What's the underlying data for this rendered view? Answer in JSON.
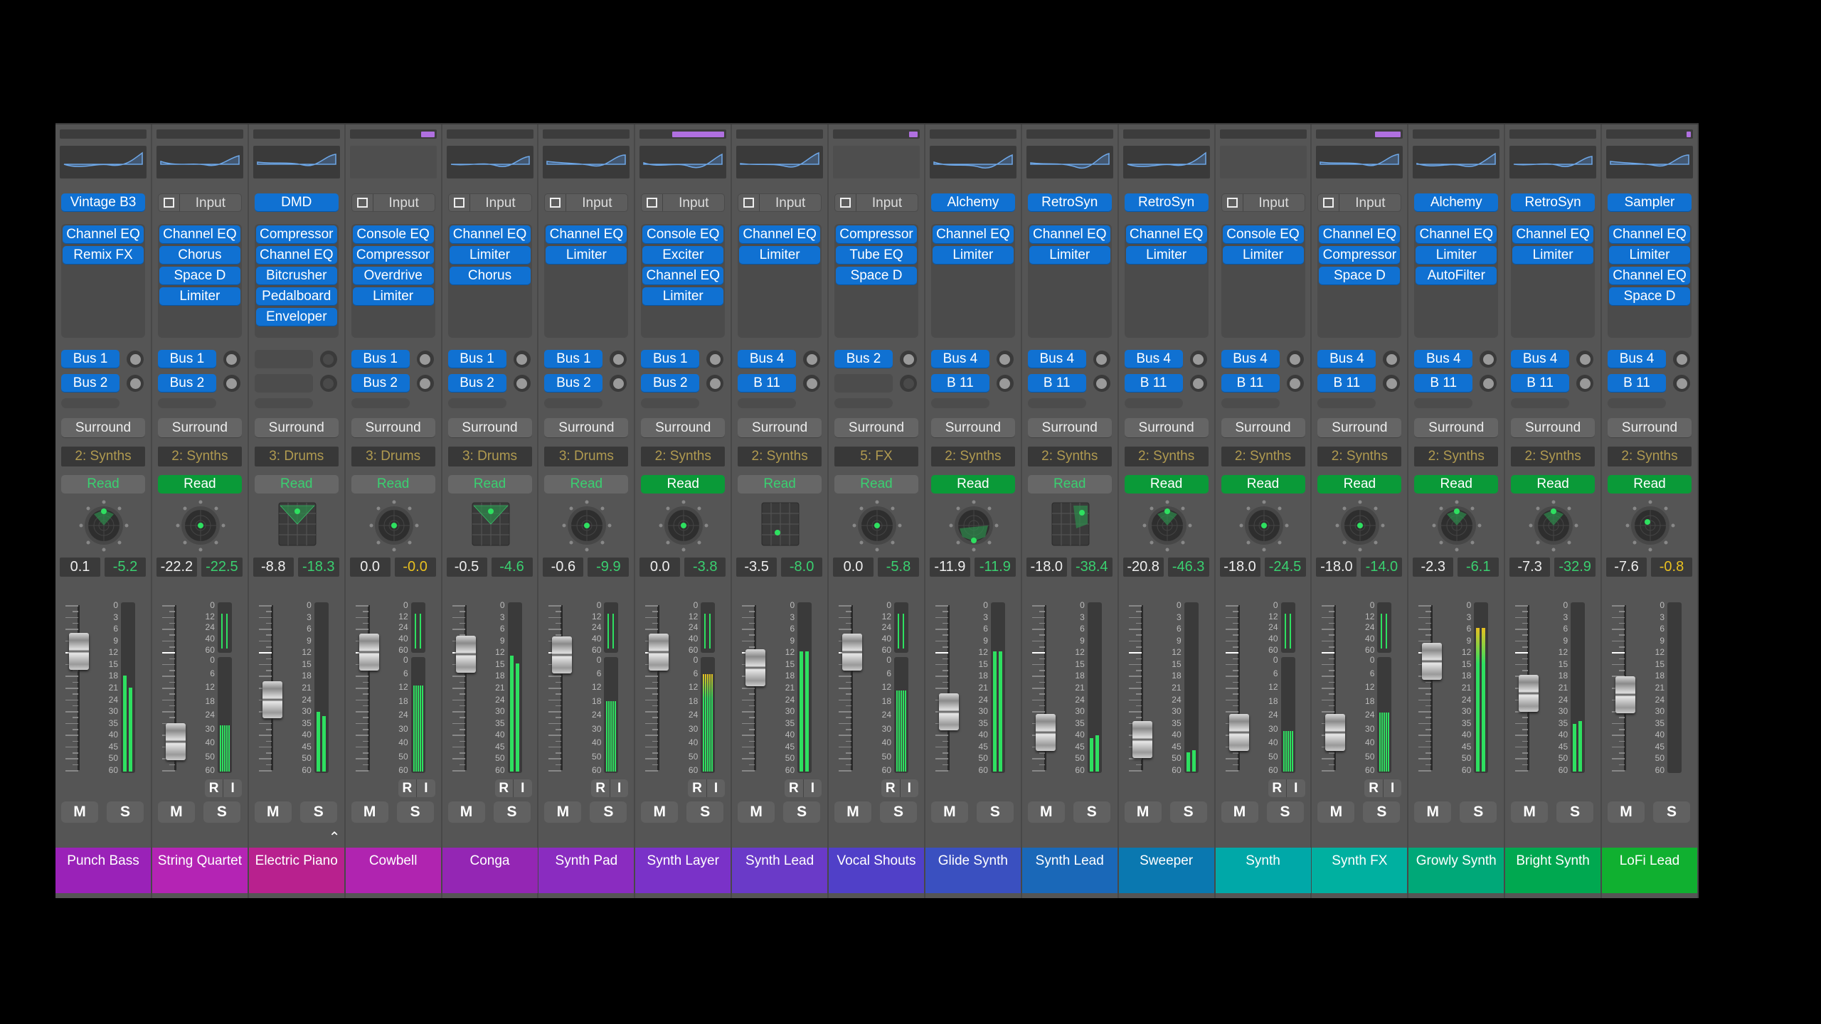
{
  "colors": {
    "insert_blue": "#1071d2",
    "read_on": "#0a9a38",
    "read_off_text": "#3ad070",
    "peak_green": "#3ad070",
    "peak_yellow": "#e8c020",
    "group_text": "#b09a50",
    "meter_green": "#2ee060"
  },
  "labels": {
    "surround": "Surround",
    "read": "Read",
    "mute": "M",
    "solo": "S",
    "rec": "R",
    "input_monitor": "I",
    "input": "Input"
  },
  "meter_scale_single": [
    "0",
    "3",
    "6",
    "9",
    "12",
    "15",
    "18",
    "21",
    "24",
    "30",
    "35",
    "40",
    "45",
    "50",
    "60"
  ],
  "meter_scale_top": [
    "0",
    "12",
    "24",
    "40",
    "60"
  ],
  "meter_scale_bottom": [
    "0",
    "6",
    "12",
    "18",
    "24",
    "30",
    "40",
    "50",
    "60"
  ],
  "channels": [
    {
      "name": "Punch Bass",
      "color": "#9a22b8",
      "marker": 0,
      "eq": true,
      "instrument": "Vintage B3",
      "inserts": [
        "Channel EQ",
        "Remix FX"
      ],
      "sends": [
        "Bus 1",
        "Bus 2"
      ],
      "group": "2: Synths",
      "read_on": false,
      "pan": "spread-up",
      "volume": "0.1",
      "peak": "-5.2",
      "peak_color": "green",
      "meter": "single",
      "level": [
        -18,
        -21
      ],
      "ri": false
    },
    {
      "name": "String Quartet",
      "color": "#b424b4",
      "marker": 0,
      "eq": true,
      "instrument": null,
      "inserts": [
        "Channel EQ",
        "Chorus",
        "Space D",
        "Limiter"
      ],
      "sends": [
        "Bus 1",
        "Bus 2"
      ],
      "group": "2: Synths",
      "read_on": true,
      "pan": "knob",
      "volume": "-22.2",
      "peak": "-22.5",
      "peak_color": "green",
      "meter": "double",
      "level": [
        -26
      ],
      "ri": true
    },
    {
      "name": "Electric Piano",
      "color": "#b8218e",
      "marker": 0,
      "eq": true,
      "instrument": "DMD",
      "inserts": [
        "Compressor",
        "Channel EQ",
        "Bitcrusher",
        "Pedalboard",
        "Enveloper"
      ],
      "sends": [],
      "group": "3: Drums",
      "read_on": false,
      "pan": "grid-up",
      "volume": "-8.8",
      "peak": "-18.3",
      "peak_color": "green",
      "meter": "single",
      "level": [
        -30,
        -32
      ],
      "ri": false,
      "caret": true
    },
    {
      "name": "Cowbell",
      "color": "#b024b0",
      "marker": 0.15,
      "eq": false,
      "instrument": null,
      "inserts": [
        "Console EQ",
        "Compressor",
        "Overdrive",
        "Limiter"
      ],
      "sends": [
        "Bus 1",
        "Bus 2"
      ],
      "group": "3: Drums",
      "read_on": false,
      "pan": "knob",
      "volume": "0.0",
      "peak": "-0.0",
      "peak_color": "yellow",
      "meter": "double",
      "level": [
        -10
      ],
      "ri": true
    },
    {
      "name": "Conga",
      "color": "#9426b4",
      "marker": 0,
      "eq": true,
      "instrument": null,
      "inserts": [
        "Channel EQ",
        "Limiter",
        "Chorus"
      ],
      "sends": [
        "Bus 1",
        "Bus 2"
      ],
      "group": "3: Drums",
      "read_on": false,
      "pan": "grid-up",
      "volume": "-0.5",
      "peak": "-4.6",
      "peak_color": "green",
      "meter": "single",
      "level": [
        -13,
        -15
      ],
      "ri": true
    },
    {
      "name": "Synth Pad",
      "color": "#8a2cc0",
      "marker": 0,
      "eq": true,
      "instrument": null,
      "inserts": [
        "Channel EQ",
        "Limiter"
      ],
      "sends": [
        "Bus 1",
        "Bus 2"
      ],
      "group": "3: Drums",
      "read_on": false,
      "pan": "knob",
      "volume": "-0.6",
      "peak": "-9.9",
      "peak_color": "green",
      "meter": "double",
      "level": [
        -16
      ],
      "ri": true
    },
    {
      "name": "Synth Layer",
      "color": "#7a32c8",
      "marker": 0.6,
      "eq": true,
      "instrument": null,
      "inserts": [
        "Console EQ",
        "Exciter",
        "Channel EQ",
        "Limiter"
      ],
      "sends": [
        "Bus 1",
        "Bus 2"
      ],
      "group": "2: Synths",
      "read_on": true,
      "pan": "knob",
      "volume": "0.0",
      "peak": "-3.8",
      "peak_color": "green",
      "meter": "double",
      "level": [
        -6
      ],
      "ri": true
    },
    {
      "name": "Synth Lead",
      "color": "#6a3ac8",
      "marker": 0,
      "eq": true,
      "instrument": null,
      "inserts": [
        "Channel EQ",
        "Limiter"
      ],
      "sends": [
        "Bus 4",
        "B 11"
      ],
      "group": "2: Synths",
      "read_on": false,
      "pan": "grid-low",
      "volume": "-3.5",
      "peak": "-8.0",
      "peak_color": "green",
      "meter": "single",
      "level": [
        -12,
        -12
      ],
      "ri": true
    },
    {
      "name": "Vocal Shouts",
      "color": "#5040c8",
      "marker": 0.1,
      "eq": false,
      "instrument": null,
      "inserts": [
        "Compressor",
        "Tube EQ",
        "Space D"
      ],
      "sends": [
        "Bus 2"
      ],
      "group": "5: FX",
      "read_on": false,
      "pan": "knob",
      "volume": "0.0",
      "peak": "-5.8",
      "peak_color": "green",
      "meter": "double",
      "level": [
        -12
      ],
      "ri": true
    },
    {
      "name": "Glide Synth",
      "color": "#3a50c0",
      "marker": 0,
      "eq": true,
      "instrument": "Alchemy",
      "inserts": [
        "Channel EQ",
        "Limiter"
      ],
      "sends": [
        "Bus 4",
        "B 11"
      ],
      "group": "2: Synths",
      "read_on": true,
      "pan": "spread-down",
      "volume": "-11.9",
      "peak": "-11.9",
      "peak_color": "green",
      "meter": "single",
      "level": [
        -12,
        -12
      ],
      "ri": false
    },
    {
      "name": "Synth Lead",
      "color": "#1a68b8",
      "marker": 0,
      "eq": true,
      "instrument": "RetroSyn",
      "inserts": [
        "Channel EQ",
        "Limiter"
      ],
      "sends": [
        "Bus 4",
        "B 11"
      ],
      "group": "2: Synths",
      "read_on": false,
      "pan": "grid-right",
      "volume": "-18.0",
      "peak": "-38.4",
      "peak_color": "green",
      "meter": "single",
      "level": [
        -41,
        -40
      ],
      "ri": false
    },
    {
      "name": "Sweeper",
      "color": "#0a78b0",
      "marker": 0,
      "eq": true,
      "instrument": "RetroSyn",
      "inserts": [
        "Channel EQ",
        "Limiter"
      ],
      "sends": [
        "Bus 4",
        "B 11"
      ],
      "group": "2: Synths",
      "read_on": true,
      "pan": "spread-up",
      "volume": "-20.8",
      "peak": "-46.3",
      "peak_color": "green",
      "meter": "single",
      "level": [
        -47,
        -46
      ],
      "ri": false
    },
    {
      "name": "Synth",
      "color": "#00a8a8",
      "marker": 0,
      "eq": false,
      "instrument": null,
      "inserts": [
        "Console EQ",
        "Limiter"
      ],
      "sends": [
        "Bus 4",
        "B 11"
      ],
      "group": "2: Synths",
      "read_on": true,
      "pan": "knob",
      "volume": "-18.0",
      "peak": "-24.5",
      "peak_color": "green",
      "meter": "double",
      "level": [
        -30
      ],
      "ri": true
    },
    {
      "name": "Synth FX",
      "color": "#00b0a0",
      "marker": 0.3,
      "eq": true,
      "instrument": null,
      "inserts": [
        "Channel EQ",
        "Compressor",
        "Space D"
      ],
      "sends": [
        "Bus 4",
        "B 11"
      ],
      "group": "2: Synths",
      "read_on": true,
      "pan": "knob",
      "volume": "-18.0",
      "peak": "-14.0",
      "peak_color": "green",
      "meter": "double",
      "level": [
        -20
      ],
      "ri": true
    },
    {
      "name": "Growly Synth",
      "color": "#00a878",
      "marker": 0,
      "eq": true,
      "instrument": "Alchemy",
      "inserts": [
        "Channel EQ",
        "Limiter",
        "AutoFilter"
      ],
      "sends": [
        "Bus 4",
        "B 11"
      ],
      "group": "2: Synths",
      "read_on": true,
      "pan": "spread-up",
      "volume": "-2.3",
      "peak": "-6.1",
      "peak_color": "green",
      "meter": "single",
      "level": [
        -6,
        -6
      ],
      "ri": false
    },
    {
      "name": "Bright Synth",
      "color": "#00a850",
      "marker": 0,
      "eq": true,
      "instrument": "RetroSyn",
      "inserts": [
        "Channel EQ",
        "Limiter"
      ],
      "sends": [
        "Bus 4",
        "B 11"
      ],
      "group": "2: Synths",
      "read_on": true,
      "pan": "spread-up",
      "volume": "-7.3",
      "peak": "-32.9",
      "peak_color": "green",
      "meter": "single",
      "level": [
        -35,
        -34
      ],
      "ri": false
    },
    {
      "name": "LoFi Lead",
      "color": "#10b030",
      "marker": 0.03,
      "eq": true,
      "instrument": "Sampler",
      "inserts": [
        "Channel EQ",
        "Limiter",
        "Channel EQ",
        "Space D"
      ],
      "sends": [
        "Bus 4",
        "B 11"
      ],
      "group": "2: Synths",
      "read_on": true,
      "pan": "knob-left",
      "volume": "-7.6",
      "peak": "-0.8",
      "peak_color": "yellow",
      "meter": "single",
      "level": [],
      "ri": false
    }
  ]
}
